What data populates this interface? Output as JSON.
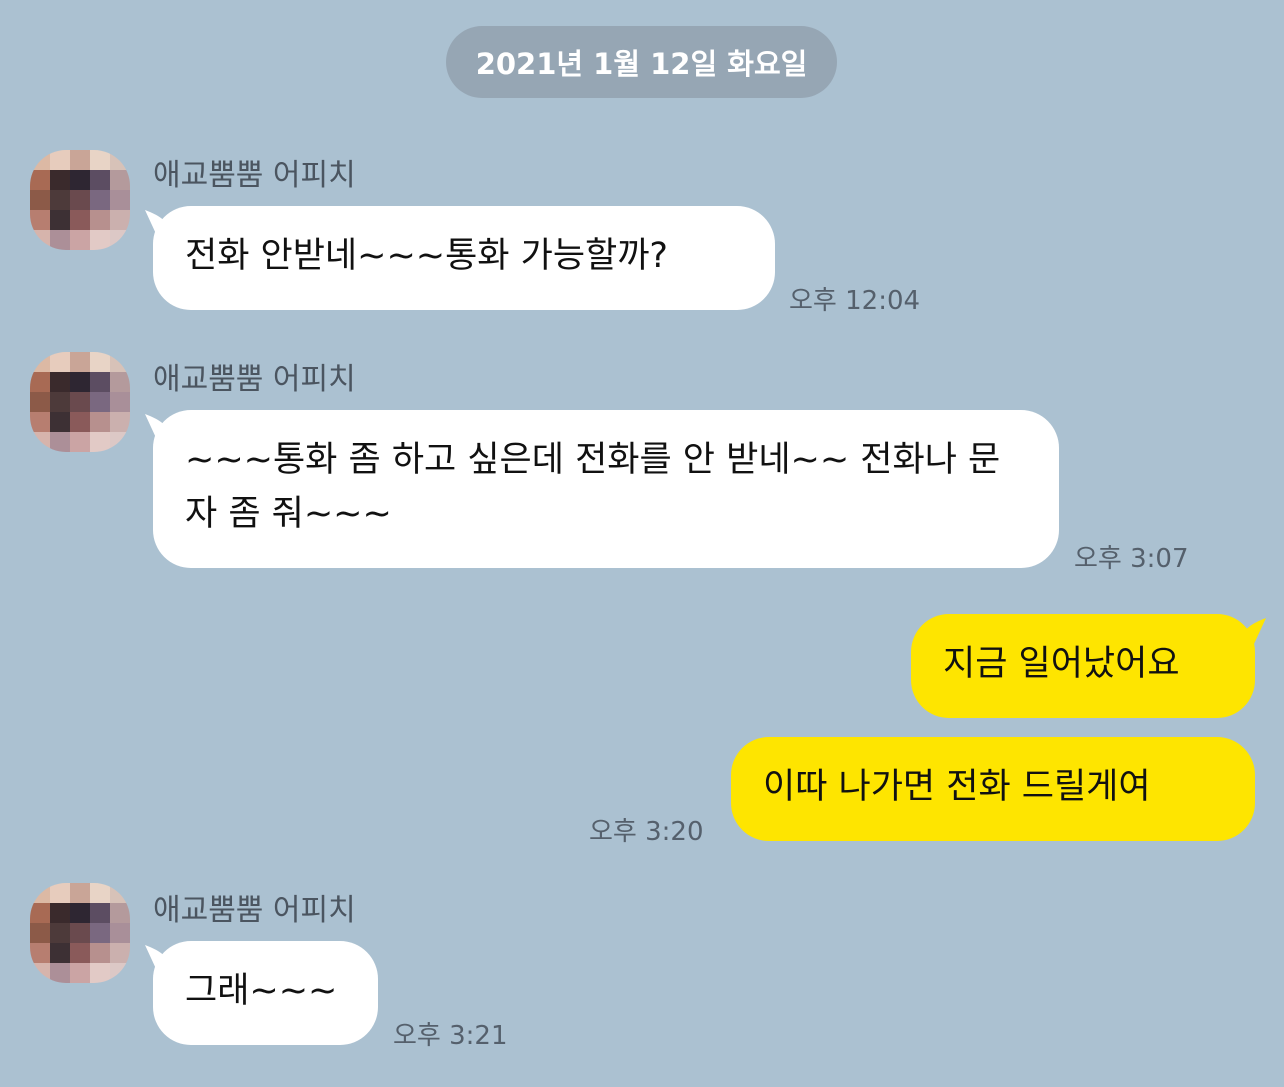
{
  "date_divider": "2021년 1월 12일 화요일",
  "colors": {
    "background": "#abc1d1",
    "my_bubble": "#fee500",
    "their_bubble": "#ffffff",
    "date_pill": "#96a6b4"
  },
  "messages": [
    {
      "sender": "애교뿜뿜 어피치",
      "text": "전화 안받네~~~통화 가능할까?",
      "time": "오후 12:04",
      "mine": false
    },
    {
      "sender": "애교뿜뿜 어피치",
      "text": "~~~통화 좀 하고 싶은데 전화를 안 받네~~ 전화나  문자 좀 줘~~~",
      "time": "오후 3:07",
      "mine": false
    },
    {
      "text": "지금 일어났어요",
      "mine": true
    },
    {
      "text": "이따 나가면 전화 드릴게여",
      "time": "오후 3:20",
      "mine": true
    },
    {
      "sender": "애교뿜뿜 어피치",
      "text": "그래~~~",
      "time": "오후 3:21",
      "mine": false
    }
  ],
  "avatar_icon": "blurred-profile-picture"
}
